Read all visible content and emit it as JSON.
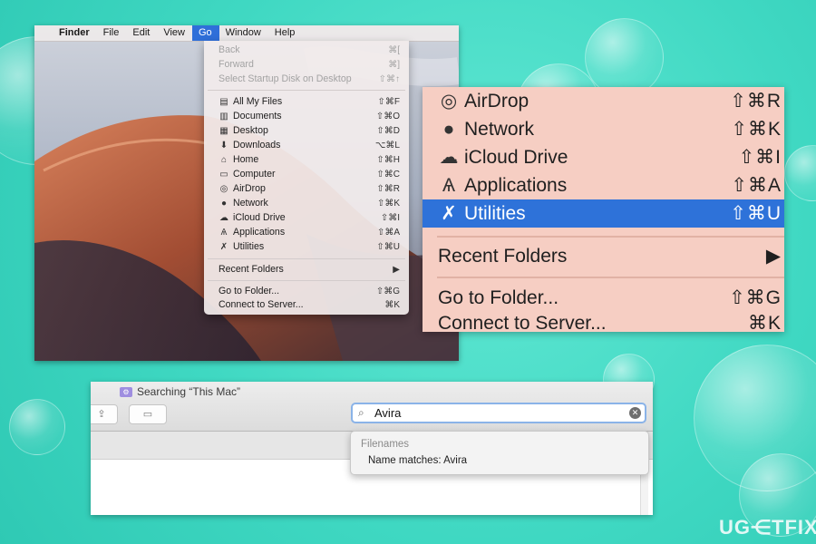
{
  "menubar": {
    "apple": "",
    "app": "Finder",
    "items": [
      "File",
      "Edit",
      "View",
      "Go",
      "Window",
      "Help"
    ]
  },
  "go_menu": {
    "items": [
      {
        "label": "Back",
        "shortcut": "⌘[",
        "disabled": true,
        "icon": ""
      },
      {
        "label": "Forward",
        "shortcut": "⌘]",
        "disabled": true,
        "icon": ""
      },
      {
        "label": "Select Startup Disk on Desktop",
        "shortcut": "⇧⌘↑",
        "disabled": true,
        "icon": ""
      },
      {
        "label": "All My Files",
        "shortcut": "⇧⌘F",
        "icon": "all-files-icon"
      },
      {
        "label": "Documents",
        "shortcut": "⇧⌘O",
        "icon": "documents-icon"
      },
      {
        "label": "Desktop",
        "shortcut": "⇧⌘D",
        "icon": "desktop-icon"
      },
      {
        "label": "Downloads",
        "shortcut": "⌥⌘L",
        "icon": "downloads-icon"
      },
      {
        "label": "Home",
        "shortcut": "⇧⌘H",
        "icon": "home-icon"
      },
      {
        "label": "Computer",
        "shortcut": "⇧⌘C",
        "icon": "computer-icon"
      },
      {
        "label": "AirDrop",
        "shortcut": "⇧⌘R",
        "icon": "airdrop-icon"
      },
      {
        "label": "Network",
        "shortcut": "⇧⌘K",
        "icon": "network-icon"
      },
      {
        "label": "iCloud Drive",
        "shortcut": "⇧⌘I",
        "icon": "icloud-icon"
      },
      {
        "label": "Applications",
        "shortcut": "⇧⌘A",
        "icon": "applications-icon"
      },
      {
        "label": "Utilities",
        "shortcut": "⇧⌘U",
        "icon": "utilities-icon"
      },
      {
        "label": "Recent Folders",
        "shortcut": "▶",
        "icon": ""
      },
      {
        "label": "Go to Folder...",
        "shortcut": "⇧⌘G",
        "icon": ""
      },
      {
        "label": "Connect to Server...",
        "shortcut": "⌘K",
        "icon": ""
      }
    ]
  },
  "zoom_menu": {
    "items": [
      {
        "label": "AirDrop",
        "shortcut": "⇧⌘R",
        "icon": "airdrop-icon"
      },
      {
        "label": "Network",
        "shortcut": "⇧⌘K",
        "icon": "network-icon"
      },
      {
        "label": "iCloud Drive",
        "shortcut": "⇧⌘I",
        "icon": "icloud-icon"
      },
      {
        "label": "Applications",
        "shortcut": "⇧⌘A",
        "icon": "applications-icon"
      },
      {
        "label": "Utilities",
        "shortcut": "⇧⌘U",
        "icon": "utilities-icon",
        "selected": true
      },
      {
        "label": "Recent Folders",
        "shortcut": "▶",
        "icon": ""
      },
      {
        "label": "Go to Folder...",
        "shortcut": "⇧⌘G",
        "icon": ""
      },
      {
        "label": "Connect to Server...",
        "shortcut": "⌘K",
        "icon": ""
      }
    ]
  },
  "finder_window": {
    "title": "Searching “This Mac”",
    "search_value": "Avira",
    "suggestions_header": "Filenames",
    "suggestion_item": "Name matches: Avira"
  },
  "brand": "UG⋲TFIX",
  "colors": {
    "accent": "#2e72d9",
    "background": "#3fd8c2",
    "zoom_bg": "#f6cec3"
  }
}
